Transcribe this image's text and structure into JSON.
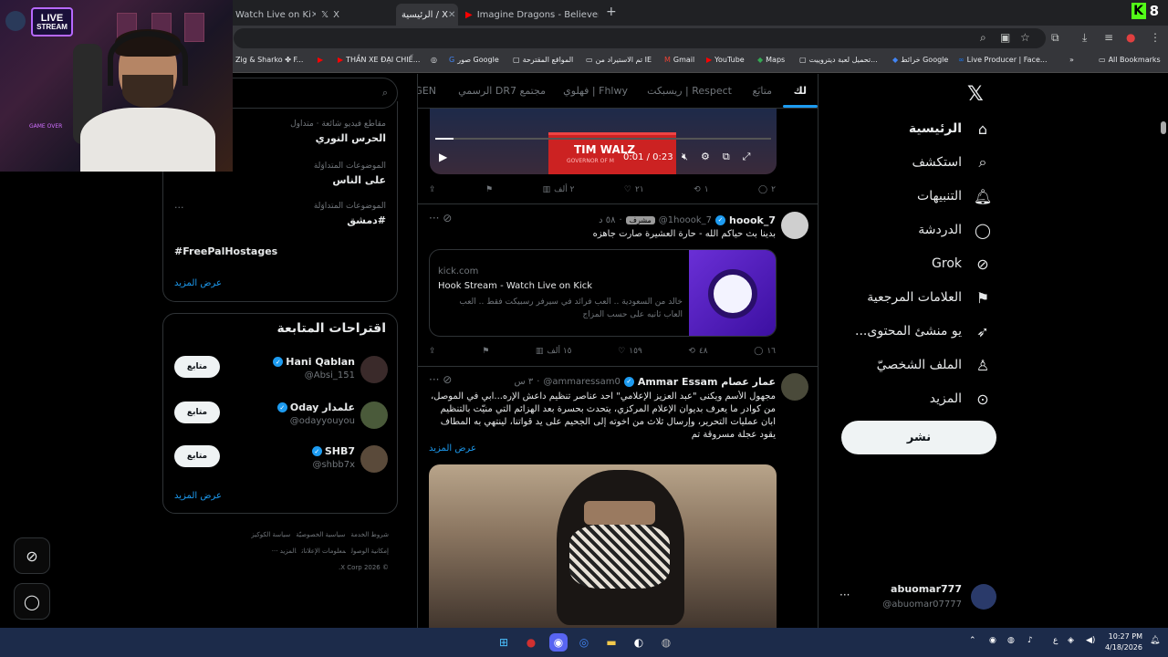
{
  "browser": {
    "tabs": [
      {
        "label": "Watch Live on Ki",
        "icon": "kick-icon",
        "active": false
      },
      {
        "label": "X",
        "icon": "x-icon",
        "active": false
      },
      {
        "label": "الرئيسية / X",
        "icon": "x-icon",
        "active": true
      },
      {
        "label": "Imagine Dragons - Believer (Lyr",
        "icon": "youtube-icon",
        "active": false
      }
    ],
    "corner_badge": "8",
    "bookmarks": [
      {
        "label": "Zig & Sharko ✤ F...",
        "color": "#e8eaed"
      },
      {
        "label": "",
        "color": "#ff0000"
      },
      {
        "label": "THẦN XE ĐẠI CHIẾ...",
        "color": "#ff0000"
      },
      {
        "label": "",
        "color": "#ffffff"
      },
      {
        "label": "صور Google",
        "color": "#4285f4"
      },
      {
        "label": "المواقع المقترحة",
        "color": "#e8eaed"
      },
      {
        "label": "تم الاستيراد من IE",
        "color": "#e8eaed"
      },
      {
        "label": "Gmail",
        "color": "#ea4335"
      },
      {
        "label": "YouTube",
        "color": "#ff0000"
      },
      {
        "label": "Maps",
        "color": "#34a853"
      },
      {
        "label": "تحميل لعبة ديتروييت...",
        "color": "#e8eaed"
      },
      {
        "label": "خرائط Google",
        "color": "#4285f4"
      },
      {
        "label": "Live Producer | Face...",
        "color": "#1877f2"
      },
      {
        "label": "All Bookmarks",
        "color": "#e8eaed"
      }
    ]
  },
  "webcam": {
    "live_word": "LIVE",
    "stream_word": "STREAM",
    "sign_text": "GAME OVER"
  },
  "nav": {
    "items": [
      {
        "label": "الرئيسية",
        "icon": "home-icon"
      },
      {
        "label": "استكشف",
        "icon": "search-icon"
      },
      {
        "label": "التنبيهات",
        "icon": "bell-icon"
      },
      {
        "label": "الدردشة",
        "icon": "chat-icon"
      },
      {
        "label": "Grok",
        "icon": "grok-icon"
      },
      {
        "label": "العلامات المرجعية",
        "icon": "bookmark-icon"
      },
      {
        "label": "...يو منشئ المحتوى",
        "icon": "rocket-icon"
      },
      {
        "label": "الملف الشخصيّ",
        "icon": "person-icon"
      },
      {
        "label": "المزيد",
        "icon": "more-circle-icon"
      }
    ],
    "post_label": "نشر",
    "account": {
      "name": "abuomar777",
      "handle": "@abuomar07777"
    }
  },
  "feed": {
    "tabs": [
      "لك",
      "متابَع",
      "Respect | ريسبكت",
      "Fhlwy | فهلوي",
      "مجتمع DR7 الرسمي",
      "GEN"
    ],
    "video": {
      "headline": "TIM WALZ",
      "subline": "GOVERNOR OF M",
      "time": "0:01 / 0:23"
    },
    "tweet0_actions": {
      "replies": "٢",
      "reposts": "١",
      "likes": "٢١",
      "views": "٢ ألف"
    },
    "tweet1": {
      "name": "hoook_7",
      "handle": "@1hoook_7",
      "badge": "مشرف",
      "time": "٥٨ د",
      "text": "بدينا بث حياكم الله - حارة العشيرة صارت جاهزه",
      "card": {
        "domain": "kick.com",
        "title": "Hook Stream - Watch Live on Kick",
        "desc": "خالد من السعودية .. العب فرائد في سيرفر رسبيكت فقط .. العب العاب ثانيه على حسب المزاج"
      },
      "actions": {
        "replies": "١٦",
        "reposts": "٤٨",
        "likes": "١٥٩",
        "views": "١٥ ألف"
      }
    },
    "tweet2": {
      "name": "Ammar Essam عمار عصام",
      "handle": "@ammaressam0",
      "time": "٣ س",
      "text": "مجهول الأسم ويكنى \"عبد العزيز الإعلامي\" احد عناصر تنظيم داعش الإره...ابي في الموصل، من كوادر ما يعرف بديوان الإعلام المركزي، يتحدث بحسرة بعد الهزائم التي منيّت بالتنظيم ابان عمليات التحرير، وإرسال ثلاث من اخوته إلى الجحيم على يد قواتنا، لينتهي به المطاف يقود عجلة مسروقة تم",
      "show_more": "عرض المزيد"
    }
  },
  "side": {
    "trends": [
      {
        "meta": "مقاطع فيديو شائعة · متداول",
        "name": "الحرس النوري"
      },
      {
        "meta": "الموضوعات المتداوَلة",
        "name": "على الناس"
      },
      {
        "meta": "الموضوعات المتداوَلة",
        "name": "#دمشق"
      },
      {
        "meta": "",
        "name": "#FreePalHostages"
      }
    ],
    "trends_show_more": "عرض المزيد",
    "suggest_title": "اقتراحات المتابعة",
    "follow_label": "متابع",
    "suggestions": [
      {
        "name": "Hani Qablan",
        "handle": "@Absi_151",
        "color": "#3a2a2a"
      },
      {
        "name": "Oday علمدار",
        "handle": "@odayyouyou",
        "color": "#4a5a3a"
      },
      {
        "name": "SHB7",
        "handle": "@shbb7x",
        "color": "#5a4a3a"
      }
    ],
    "suggest_show_more": "عرض المزيد",
    "footer": [
      "شروط الخدمة",
      "سياسية الخصوصيّة",
      "سياسة الكوكيز",
      "إمكانية الوصول",
      "معلومات الإعلانات",
      "المزيد ···",
      "© 2026 X Corp."
    ]
  },
  "taskbar": {
    "time": "10:27 PM",
    "date": "4/18/2026",
    "lang": "ع"
  }
}
